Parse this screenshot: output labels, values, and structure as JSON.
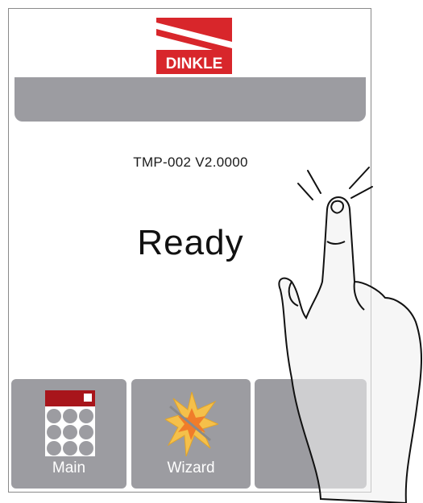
{
  "header": {
    "logo_text": "DINKLE",
    "brand_color": "#d8262b"
  },
  "device": {
    "model_version": "TMP-002 V2.0000",
    "status": "Ready"
  },
  "tiles": [
    {
      "label": "Main",
      "icon": "keypad-grid-icon"
    },
    {
      "label": "Wizard",
      "icon": "starburst-wand-icon"
    },
    {
      "label": "",
      "icon": ""
    }
  ],
  "colors": {
    "panel_gray": "#9c9ca1",
    "accent_red": "#a8151b"
  }
}
